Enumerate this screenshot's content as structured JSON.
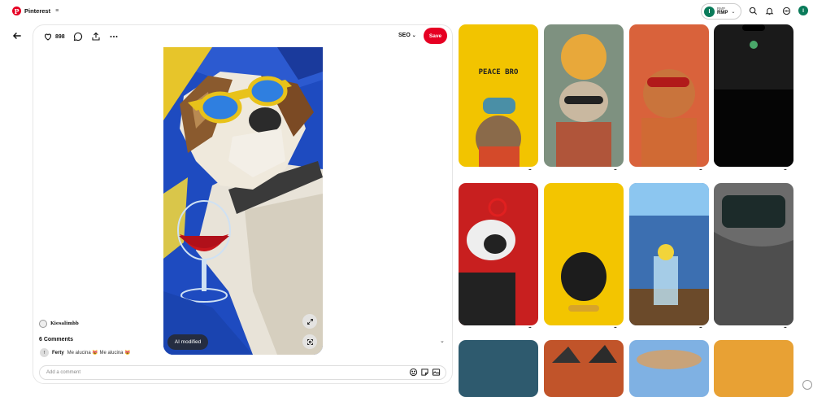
{
  "app": {
    "name": "Pinterest",
    "logo_letter": "P"
  },
  "account": {
    "initial": "I",
    "small_label": "RMP",
    "name": "RMP"
  },
  "topbar_icons": [
    "search-icon",
    "bell-icon",
    "chat-icon"
  ],
  "pin": {
    "likes": "898",
    "seo_label": "SEO",
    "save_label": "Save",
    "ai_label": "AI modified",
    "creator": "Kiesalimbb",
    "comments_header": "6 Comments",
    "comment_user_initial": "f",
    "comment_user": "Ferty",
    "comment_text": "Me alucina 😻 Me alucina 😻",
    "add_comment_placeholder": "Add a comment"
  },
  "feed": {
    "more_label": "...",
    "items": [
      {
        "theme": "peace-monkey",
        "bg": "#f2c400",
        "text": "PEACE BRO"
      },
      {
        "theme": "cat-sun",
        "bg": "#7e9180",
        "text": ""
      },
      {
        "theme": "dog-cigar",
        "bg": "#d9623b",
        "text": ""
      },
      {
        "theme": "dark-wallpaper",
        "bg": "#1a1a1a",
        "text": ""
      },
      {
        "theme": "cow-red",
        "bg": "#c81f1f",
        "text": ""
      },
      {
        "theme": "black-dog-yellow",
        "bg": "#f3c500",
        "text": ""
      },
      {
        "theme": "drink-window",
        "bg": "#3c6fb1",
        "text": ""
      },
      {
        "theme": "dragon-pattern",
        "bg": "#6b6b6b",
        "text": ""
      },
      {
        "theme": "teal",
        "bg": "#2e5a6e",
        "text": ""
      },
      {
        "theme": "dogs-orange",
        "bg": "#c1542a",
        "text": ""
      },
      {
        "theme": "dog-sky",
        "bg": "#7fb1e3",
        "text": ""
      },
      {
        "theme": "orange",
        "bg": "#e8a134",
        "text": ""
      }
    ]
  },
  "colors": {
    "brand": "#e60023",
    "avatar": "#0a7b5a"
  }
}
